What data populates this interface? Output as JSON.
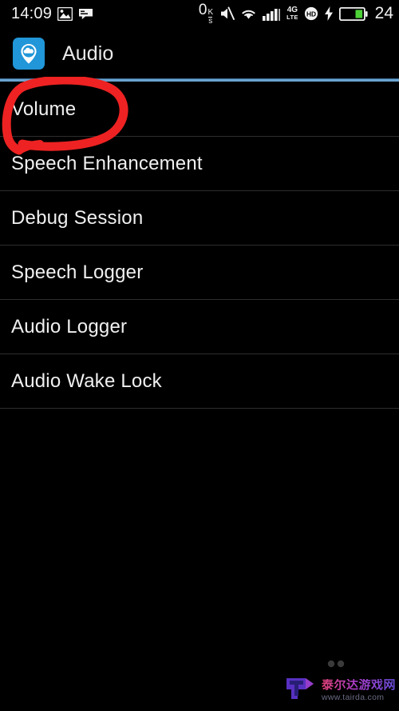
{
  "status_bar": {
    "time": "14:09",
    "left_icons": [
      "image-icon",
      "message-icon"
    ],
    "network_speed": "0",
    "speed_unit_top": "K",
    "speed_unit_bottom": "s",
    "right_icons": [
      "mute-icon",
      "wifi-icon",
      "signal-bars-icon",
      "volte-hd-icon",
      "charging-bolt-icon",
      "battery-icon"
    ],
    "network_type_top": "4G",
    "network_type_bottom": "LTE",
    "battery_percent": "24",
    "battery_color": "#4cd137"
  },
  "app_bar": {
    "icon_name": "audio-app-icon",
    "icon_bg": "#2196d8",
    "title": "Audio",
    "accent_color": "#6ba3d0"
  },
  "list": {
    "items": [
      {
        "label": "Volume"
      },
      {
        "label": "Speech Enhancement"
      },
      {
        "label": "Debug Session"
      },
      {
        "label": "Speech Logger"
      },
      {
        "label": "Audio Logger"
      },
      {
        "label": "Audio Wake Lock"
      }
    ]
  },
  "annotation": {
    "name": "red-circle-highlight",
    "target": "Volume",
    "color": "#ee2222"
  },
  "watermark": {
    "brand_cn": "泰尔达游戏网",
    "url": "www.tairda.com",
    "logo_name": "tairda-t-logo"
  }
}
